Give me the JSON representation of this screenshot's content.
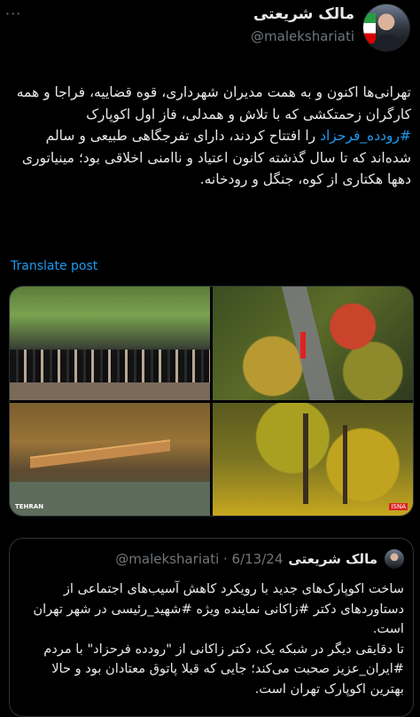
{
  "tweet": {
    "author_name": "مالک شریعتی",
    "handle": "@malekshariati",
    "text_part1": "تهرانی‌ها اکنون و به همت مدیران شهرداری، قوه قضاییه، فراجا و همه کارگران زحمتکشی که با تلاش و همدلی، فاز اول اکوپارک ",
    "hashtag": "#رودده_فرحزاد",
    "text_part2": " را افتتاح کردند، دارای تفرجگاهی طبیعی و سالم شده‌اند که تا سال گذشته کانون اعتیاد و ناامنی اخلاقی بود؛ مینیاتوری دهها هکتاری از کوه، جنگل و رودخانه.",
    "translate_label": "Translate post"
  },
  "media": {
    "photos": [
      {
        "name": "ceremony-crowd"
      },
      {
        "name": "aerial-autumn-path"
      },
      {
        "name": "wooden-bridge-stream",
        "watermark": "TEHRAN"
      },
      {
        "name": "autumn-forest",
        "badge": "ISNA"
      }
    ]
  },
  "quote": {
    "author_name": "مالک شریعتی",
    "handle_date": "@malekshariati · 6/13/24",
    "text": "ساخت اکوپارک‌های جدید با رویکرد کاهش آسیب‌های اجتماعی از دستاوردهای دکتر #زاکانی نماینده ویژه #شهید_رئیسی در شهر تهران است.\nتا دقایقی دیگر در شبکه یک، دکتر زاکانی از \"رودده فرحزاد\" با مردم #ایران_عزیز صحبت می‌کند؛ جایی که قبلا پاتوق معتادان بود و حالا بهترین اکوپارک تهران است."
  },
  "colors": {
    "link": "#1d9bf0",
    "muted": "#71767b",
    "text": "#e7e9ea",
    "bg": "#000000"
  }
}
